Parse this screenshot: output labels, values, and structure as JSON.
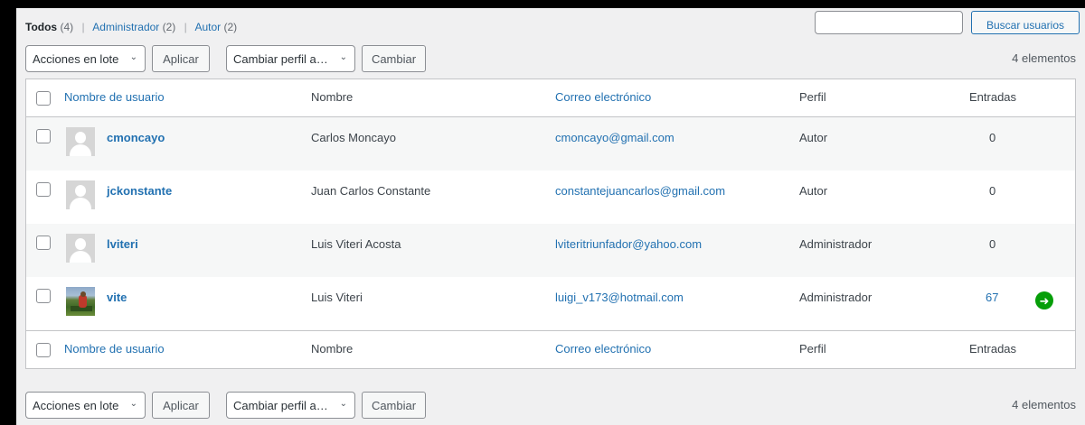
{
  "filters": {
    "all_label": "Todos",
    "all_count": "(4)",
    "admin_label": "Administrador",
    "admin_count": "(2)",
    "author_label": "Autor",
    "author_count": "(2)",
    "separator": "|"
  },
  "search": {
    "placeholder": "",
    "button_label": "Buscar usuarios"
  },
  "tablenav_top": {
    "bulk_action": "Acciones en lote",
    "apply": "Aplicar",
    "change_role": "Cambiar perfil a…",
    "change": "Cambiar",
    "count": "4 elementos"
  },
  "tablenav_bottom": {
    "bulk_action": "Acciones en lote",
    "apply": "Aplicar",
    "change_role": "Cambiar perfil a…",
    "change": "Cambiar",
    "count": "4 elementos"
  },
  "columns": {
    "username": "Nombre de usuario",
    "name": "Nombre",
    "email": "Correo electrónico",
    "role": "Perfil",
    "posts": "Entradas"
  },
  "users": [
    {
      "username": "cmoncayo",
      "name": "Carlos Moncayo",
      "email": "cmoncayo@gmail.com",
      "role": "Autor",
      "posts": "0",
      "avatar": "default-avatar"
    },
    {
      "username": "jckonstante",
      "name": "Juan Carlos Constante",
      "email": "constantejuancarlos@gmail.com",
      "role": "Autor",
      "posts": "0",
      "avatar": "default-avatar"
    },
    {
      "username": "lviteri",
      "name": "Luis Viteri Acosta",
      "email": "lviteritriunfador@yahoo.com",
      "role": "Administrador",
      "posts": "0",
      "avatar": "default-avatar"
    },
    {
      "username": "vite",
      "name": "Luis Viteri",
      "email": "luigi_v173@hotmail.com",
      "role": "Administrador",
      "posts": "67",
      "avatar": "photo-avatar"
    }
  ],
  "icons": {
    "jetpack": "jetpack-bolt-icon",
    "dropdown": "chevron-down-icon"
  },
  "colors": {
    "link": "#2271b1",
    "jetpack_green": "#069e08"
  }
}
